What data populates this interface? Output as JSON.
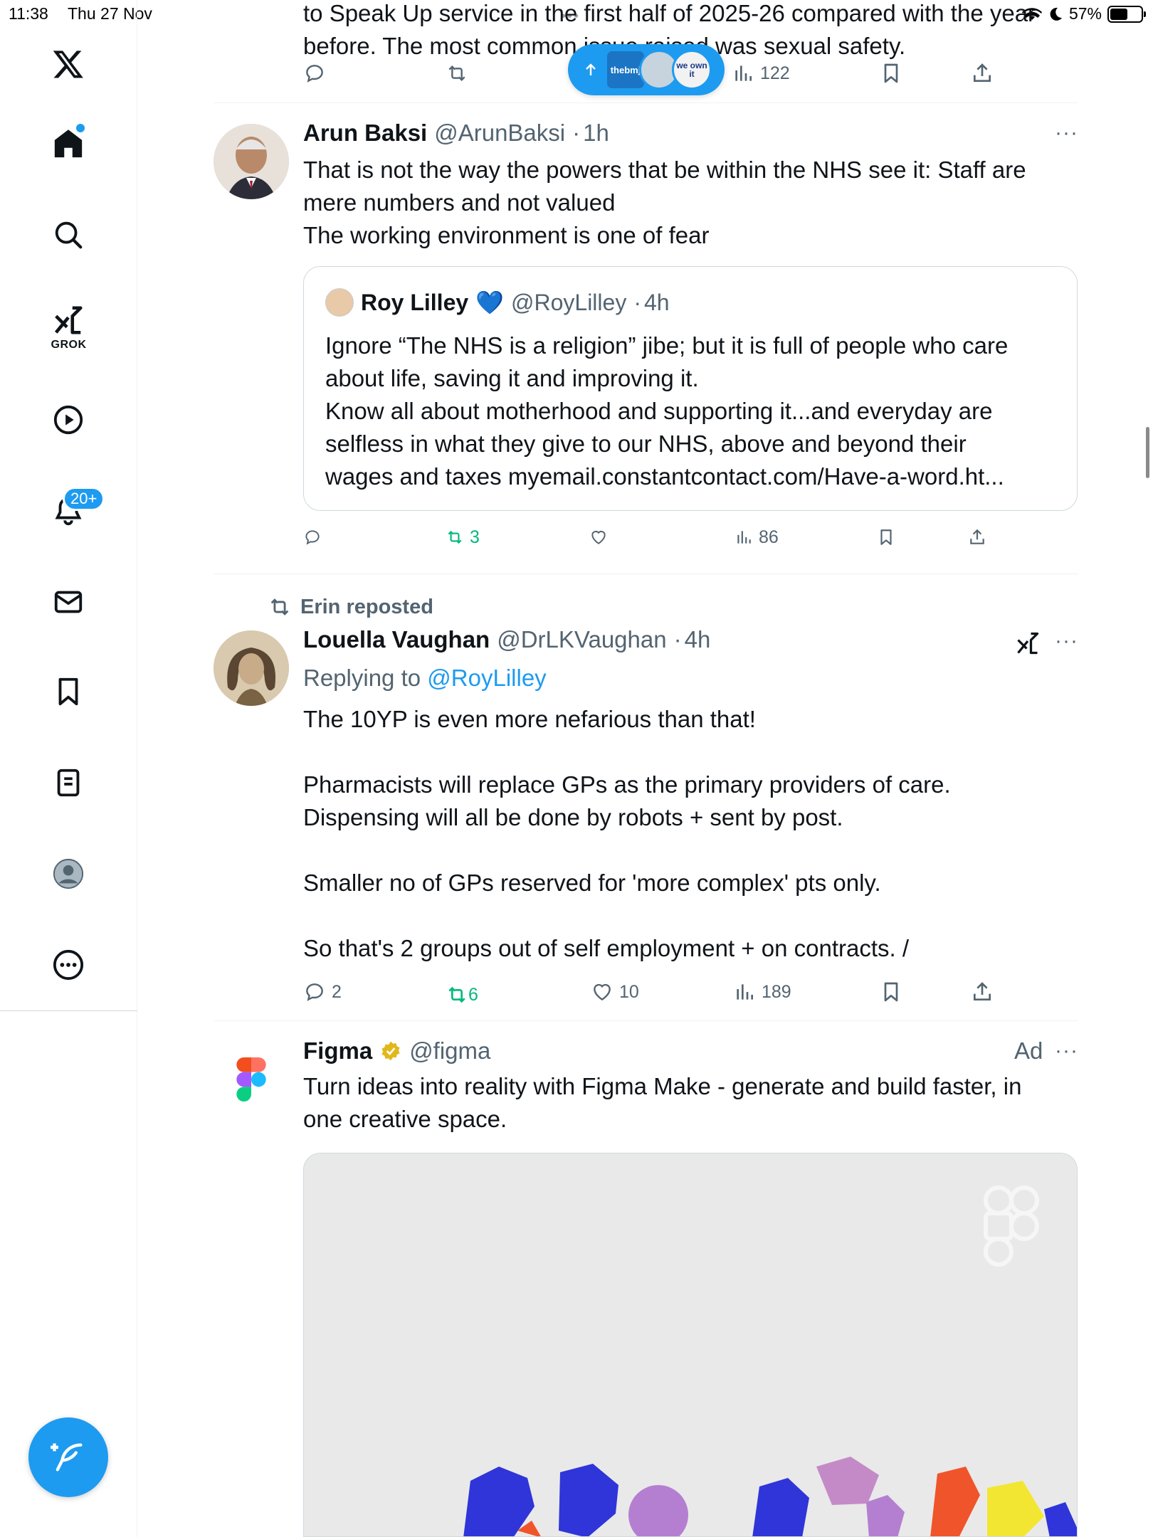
{
  "status_bar": {
    "time": "11:38",
    "date": "Thu 27 Nov",
    "battery": "57%",
    "battery_level": 0.57
  },
  "sidebar": {
    "items": [
      {
        "name": "home",
        "icon": "home-icon"
      },
      {
        "name": "explore",
        "icon": "search-icon"
      },
      {
        "name": "grok",
        "icon": "grok-icon",
        "label": "GROK"
      },
      {
        "name": "videos",
        "icon": "play-icon"
      },
      {
        "name": "notifications",
        "icon": "bell-icon",
        "badge": "20+"
      },
      {
        "name": "messages",
        "icon": "mail-icon"
      },
      {
        "name": "bookmarks",
        "icon": "bookmark-icon"
      },
      {
        "name": "lists",
        "icon": "list-icon"
      },
      {
        "name": "profile",
        "icon": "avatar-icon"
      },
      {
        "name": "more",
        "icon": "more-circle-icon"
      }
    ],
    "compose_icon": "compose-feather-icon"
  },
  "top_post": {
    "text_partial": "to Speak Up service in the first half of 2025-26 compared with the year",
    "text_line2": "before. The most common issue raised was sexual safety.",
    "views": "122",
    "new_posts_pill": {
      "avatar1": "thebmj",
      "avatar3": "we own it"
    }
  },
  "post1": {
    "name": "Arun Baksi",
    "handle": "@ArunBaksi",
    "sep": "·",
    "time": "1h",
    "more": "···",
    "text1": "That is not the way the powers that be within the NHS see it: Staff are",
    "text2": "mere numbers and not valued",
    "text3": "The working environment is one of fear",
    "quote": {
      "name": "Roy Lilley",
      "emoji": "💙",
      "handle": "@RoyLilley",
      "sep": "·",
      "time": "4h",
      "line1": "Ignore “The NHS is a religion” jibe; but it is full of people who care",
      "line2": "about life, saving it and improving it.",
      "line3": "Know all about motherhood and supporting it...and everyday are",
      "line4": "selfless in what they give to our NHS, above and beyond their",
      "line5": "wages and taxes myemail.constantcontact.com/Have-a-word.ht..."
    },
    "reposts": "3",
    "views": "86"
  },
  "post2": {
    "reposted_by": "Erin reposted",
    "name": "Louella Vaughan",
    "handle": "@DrLKVaughan",
    "sep": "·",
    "time": "4h",
    "more": "···",
    "replying_prefix": "Replying to",
    "replying_to": "@RoyLilley",
    "p1": "The 10YP is even more nefarious than that!",
    "p2a": "Pharmacists will replace GPs as the primary providers of care.",
    "p2b": "Dispensing will all be done by robots + sent by post.",
    "p3": "Smaller no of GPs reserved for 'more complex' pts only.",
    "p4": "So that's 2 groups out of self employment + on contracts. /",
    "replies": "2",
    "reposts": "6",
    "likes": "10",
    "views": "189"
  },
  "ad": {
    "name": "Figma",
    "handle": "@figma",
    "ad_label": "Ad",
    "more": "···",
    "text1": "Turn ideas into reality with Figma Make - generate and build faster, in",
    "text2": "one creative space."
  },
  "colors": {
    "accent": "#1d9bf0",
    "repost_green": "#00ba7c",
    "muted": "#536471"
  }
}
